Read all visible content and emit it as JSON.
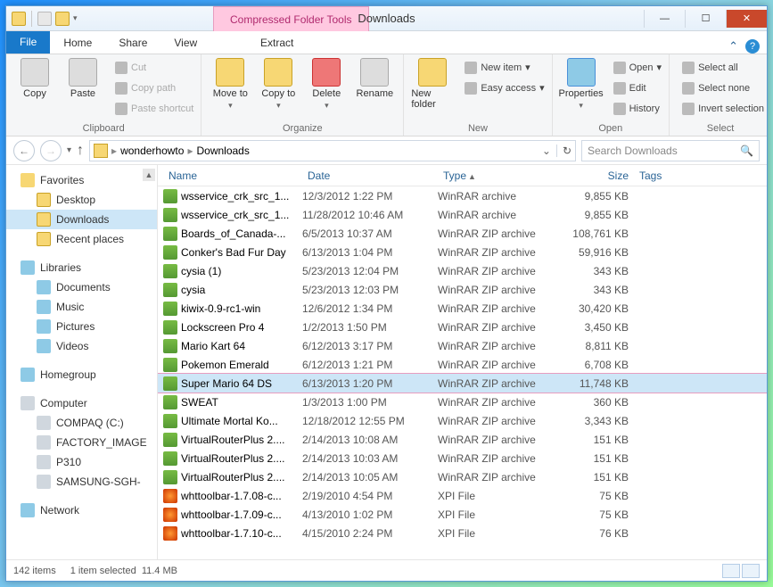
{
  "window": {
    "title": "Downloads",
    "context_tab": "Compressed Folder Tools"
  },
  "tabs": {
    "file": "File",
    "home": "Home",
    "share": "Share",
    "view": "View",
    "extract": "Extract"
  },
  "ribbon": {
    "clipboard": {
      "label": "Clipboard",
      "copy": "Copy",
      "paste": "Paste",
      "cut": "Cut",
      "copy_path": "Copy path",
      "paste_shortcut": "Paste shortcut"
    },
    "organize": {
      "label": "Organize",
      "move_to": "Move to",
      "copy_to": "Copy to",
      "delete": "Delete",
      "rename": "Rename"
    },
    "new": {
      "label": "New",
      "new_folder": "New folder",
      "new_item": "New item",
      "easy_access": "Easy access"
    },
    "open": {
      "label": "Open",
      "properties": "Properties",
      "open": "Open",
      "edit": "Edit",
      "history": "History"
    },
    "select": {
      "label": "Select",
      "select_all": "Select all",
      "select_none": "Select none",
      "invert": "Invert selection"
    }
  },
  "address": {
    "segments": [
      "wonderhowto",
      "Downloads"
    ],
    "search_placeholder": "Search Downloads"
  },
  "nav": {
    "favorites": "Favorites",
    "fav_items": [
      {
        "label": "Desktop"
      },
      {
        "label": "Downloads",
        "selected": true
      },
      {
        "label": "Recent places"
      }
    ],
    "libraries": "Libraries",
    "lib_items": [
      {
        "label": "Documents"
      },
      {
        "label": "Music"
      },
      {
        "label": "Pictures"
      },
      {
        "label": "Videos"
      }
    ],
    "homegroup": "Homegroup",
    "computer": "Computer",
    "comp_items": [
      {
        "label": "COMPAQ (C:)"
      },
      {
        "label": "FACTORY_IMAGE"
      },
      {
        "label": "P310"
      },
      {
        "label": "SAMSUNG-SGH-"
      }
    ],
    "network": "Network"
  },
  "columns": {
    "name": "Name",
    "date": "Date",
    "type": "Type",
    "size": "Size",
    "tags": "Tags"
  },
  "files": [
    {
      "name": "wsservice_crk_src_1...",
      "date": "12/3/2012 1:22 PM",
      "type": "WinRAR archive",
      "size": "9,855 KB"
    },
    {
      "name": "wsservice_crk_src_1...",
      "date": "11/28/2012 10:46 AM",
      "type": "WinRAR archive",
      "size": "9,855 KB"
    },
    {
      "name": "Boards_of_Canada-...",
      "date": "6/5/2013 10:37 AM",
      "type": "WinRAR ZIP archive",
      "size": "108,761 KB"
    },
    {
      "name": "Conker's Bad Fur Day",
      "date": "6/13/2013 1:04 PM",
      "type": "WinRAR ZIP archive",
      "size": "59,916 KB"
    },
    {
      "name": "cysia (1)",
      "date": "5/23/2013 12:04 PM",
      "type": "WinRAR ZIP archive",
      "size": "343 KB"
    },
    {
      "name": "cysia",
      "date": "5/23/2013 12:03 PM",
      "type": "WinRAR ZIP archive",
      "size": "343 KB"
    },
    {
      "name": "kiwix-0.9-rc1-win",
      "date": "12/6/2012 1:34 PM",
      "type": "WinRAR ZIP archive",
      "size": "30,420 KB"
    },
    {
      "name": "Lockscreen Pro 4",
      "date": "1/2/2013 1:50 PM",
      "type": "WinRAR ZIP archive",
      "size": "3,450 KB"
    },
    {
      "name": "Mario Kart 64",
      "date": "6/12/2013 3:17 PM",
      "type": "WinRAR ZIP archive",
      "size": "8,811 KB"
    },
    {
      "name": "Pokemon Emerald",
      "date": "6/12/2013 1:21 PM",
      "type": "WinRAR ZIP archive",
      "size": "6,708 KB"
    },
    {
      "name": "Super Mario 64 DS",
      "date": "6/13/2013 1:20 PM",
      "type": "WinRAR ZIP archive",
      "size": "11,748 KB",
      "selected": true
    },
    {
      "name": "SWEAT",
      "date": "1/3/2013 1:00 PM",
      "type": "WinRAR ZIP archive",
      "size": "360 KB"
    },
    {
      "name": "Ultimate Mortal Ko...",
      "date": "12/18/2012 12:55 PM",
      "type": "WinRAR ZIP archive",
      "size": "3,343 KB"
    },
    {
      "name": "VirtualRouterPlus 2....",
      "date": "2/14/2013 10:08 AM",
      "type": "WinRAR ZIP archive",
      "size": "151 KB"
    },
    {
      "name": "VirtualRouterPlus 2....",
      "date": "2/14/2013 10:03 AM",
      "type": "WinRAR ZIP archive",
      "size": "151 KB"
    },
    {
      "name": "VirtualRouterPlus 2....",
      "date": "2/14/2013 10:05 AM",
      "type": "WinRAR ZIP archive",
      "size": "151 KB"
    },
    {
      "name": "whttoolbar-1.7.08-c...",
      "date": "2/19/2010 4:54 PM",
      "type": "XPI File",
      "size": "75 KB",
      "xpi": true
    },
    {
      "name": "whttoolbar-1.7.09-c...",
      "date": "4/13/2010 1:02 PM",
      "type": "XPI File",
      "size": "75 KB",
      "xpi": true
    },
    {
      "name": "whttoolbar-1.7.10-c...",
      "date": "4/15/2010 2:24 PM",
      "type": "XPI File",
      "size": "76 KB",
      "xpi": true
    }
  ],
  "status": {
    "items": "142 items",
    "selected": "1 item selected",
    "size": "11.4 MB"
  }
}
